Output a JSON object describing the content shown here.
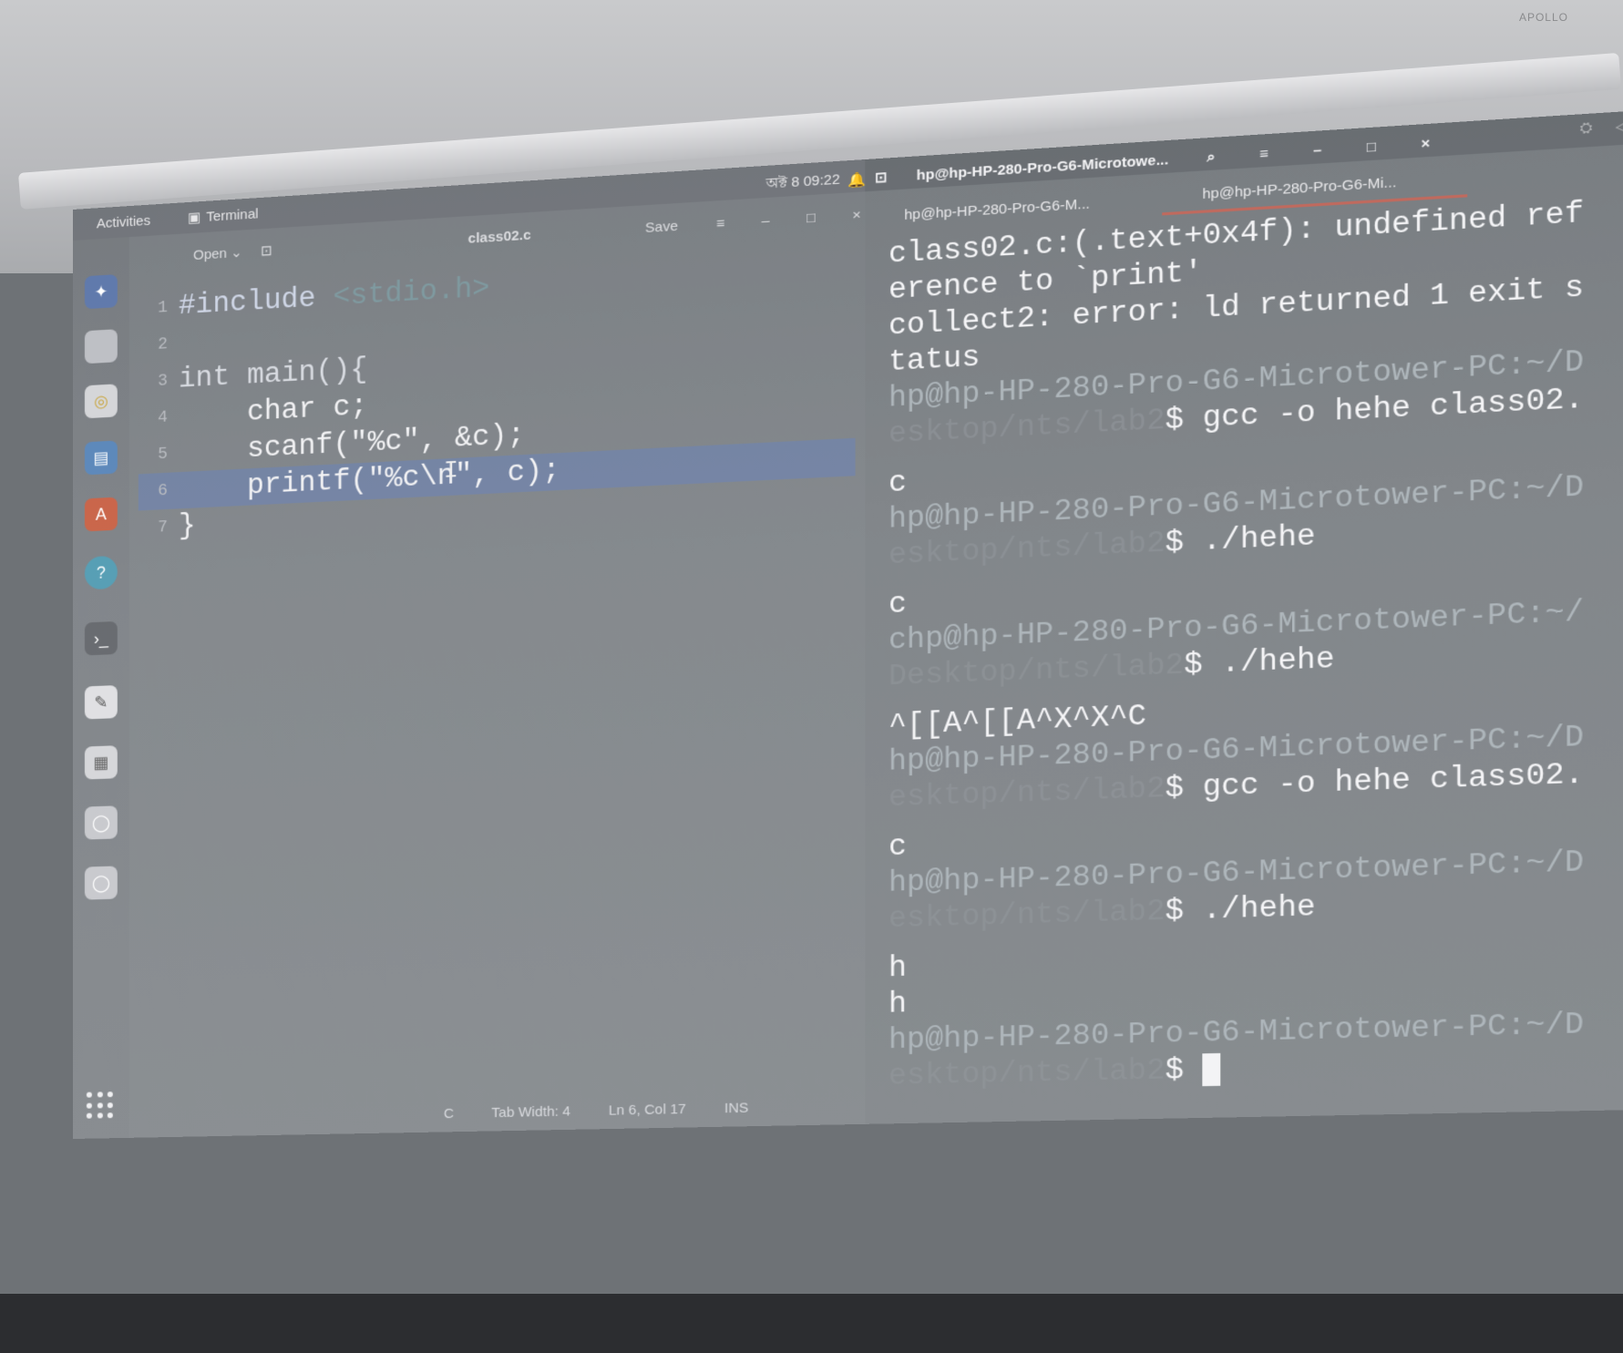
{
  "brand": "APOLLO",
  "topbar": {
    "activities": "Activities",
    "app_menu": "Terminal",
    "clock": "অক্ট 8  09:22"
  },
  "editor": {
    "open_label": "Open",
    "title": "class02.c",
    "save_label": "Save",
    "code": [
      {
        "n": "1",
        "parts": [
          {
            "c": "pp",
            "t": "#include "
          },
          {
            "c": "inc",
            "t": "<stdio.h>"
          }
        ]
      },
      {
        "n": "2",
        "parts": [
          {
            "c": "",
            "t": ""
          }
        ]
      },
      {
        "n": "3",
        "parts": [
          {
            "c": "kw",
            "t": "int main(){"
          }
        ]
      },
      {
        "n": "4",
        "parts": [
          {
            "c": "",
            "t": "    char c;"
          }
        ]
      },
      {
        "n": "5",
        "parts": [
          {
            "c": "",
            "t": "    scanf(\"%c\", &c);"
          }
        ]
      },
      {
        "n": "6",
        "parts": [
          {
            "c": "",
            "t": "    printf(\"%c\\n\", c);"
          }
        ]
      },
      {
        "n": "7",
        "parts": [
          {
            "c": "",
            "t": "}"
          }
        ]
      }
    ],
    "status": {
      "language": "C",
      "tab_width": "Tab Width: 4",
      "position": "Ln 6, Col 17",
      "mode": "INS"
    }
  },
  "terminal": {
    "window_title": "hp@hp-HP-280-Pro-G6-Microtowe...",
    "tabs": [
      "hp@hp-HP-280-Pro-G6-M...",
      "hp@hp-HP-280-Pro-G6-Mi..."
    ],
    "lines": [
      {
        "type": "out",
        "text": "class02.c:(.text+0x4f): undefined ref"
      },
      {
        "type": "out",
        "text": "erence to `print'"
      },
      {
        "type": "out",
        "text": "collect2: error: ld returned 1 exit s"
      },
      {
        "type": "out",
        "text": "tatus"
      },
      {
        "type": "prompt",
        "user": "hp@hp-HP-280-Pro-G6-Microtower-PC:",
        "path": "~/D",
        "path2": "esktop/nts/lab2",
        "cmd": "$ gcc -o hehe class02."
      },
      {
        "type": "out",
        "text": "c"
      },
      {
        "type": "prompt",
        "user": "hp@hp-HP-280-Pro-G6-Microtower-PC:",
        "path": "~/D",
        "path2": "esktop/nts/lab2",
        "cmd": "$ ./hehe"
      },
      {
        "type": "out",
        "text": "c"
      },
      {
        "type": "prompt",
        "user": "chp@hp-HP-280-Pro-G6-Microtower-PC:",
        "path": "~/",
        "path2": "Desktop/nts/lab2",
        "cmd": "$ ./hehe"
      },
      {
        "type": "out",
        "text": "^[[A^[[A^X^X^C"
      },
      {
        "type": "prompt",
        "user": "hp@hp-HP-280-Pro-G6-Microtower-PC:",
        "path": "~/D",
        "path2": "esktop/nts/lab2",
        "cmd": "$ gcc -o hehe class02."
      },
      {
        "type": "out",
        "text": "c"
      },
      {
        "type": "prompt",
        "user": "hp@hp-HP-280-Pro-G6-Microtower-PC:",
        "path": "~/D",
        "path2": "esktop/nts/lab2",
        "cmd": "$ ./hehe"
      },
      {
        "type": "out",
        "text": "h"
      },
      {
        "type": "out",
        "text": "h"
      },
      {
        "type": "prompt",
        "user": "hp@hp-HP-280-Pro-G6-Microtower-PC:",
        "path": "~/D",
        "path2": "esktop/nts/lab2",
        "cmd": "$ "
      }
    ]
  },
  "colors": {
    "selection": "#6c84ba",
    "tab_accent": "#c06a5e"
  }
}
